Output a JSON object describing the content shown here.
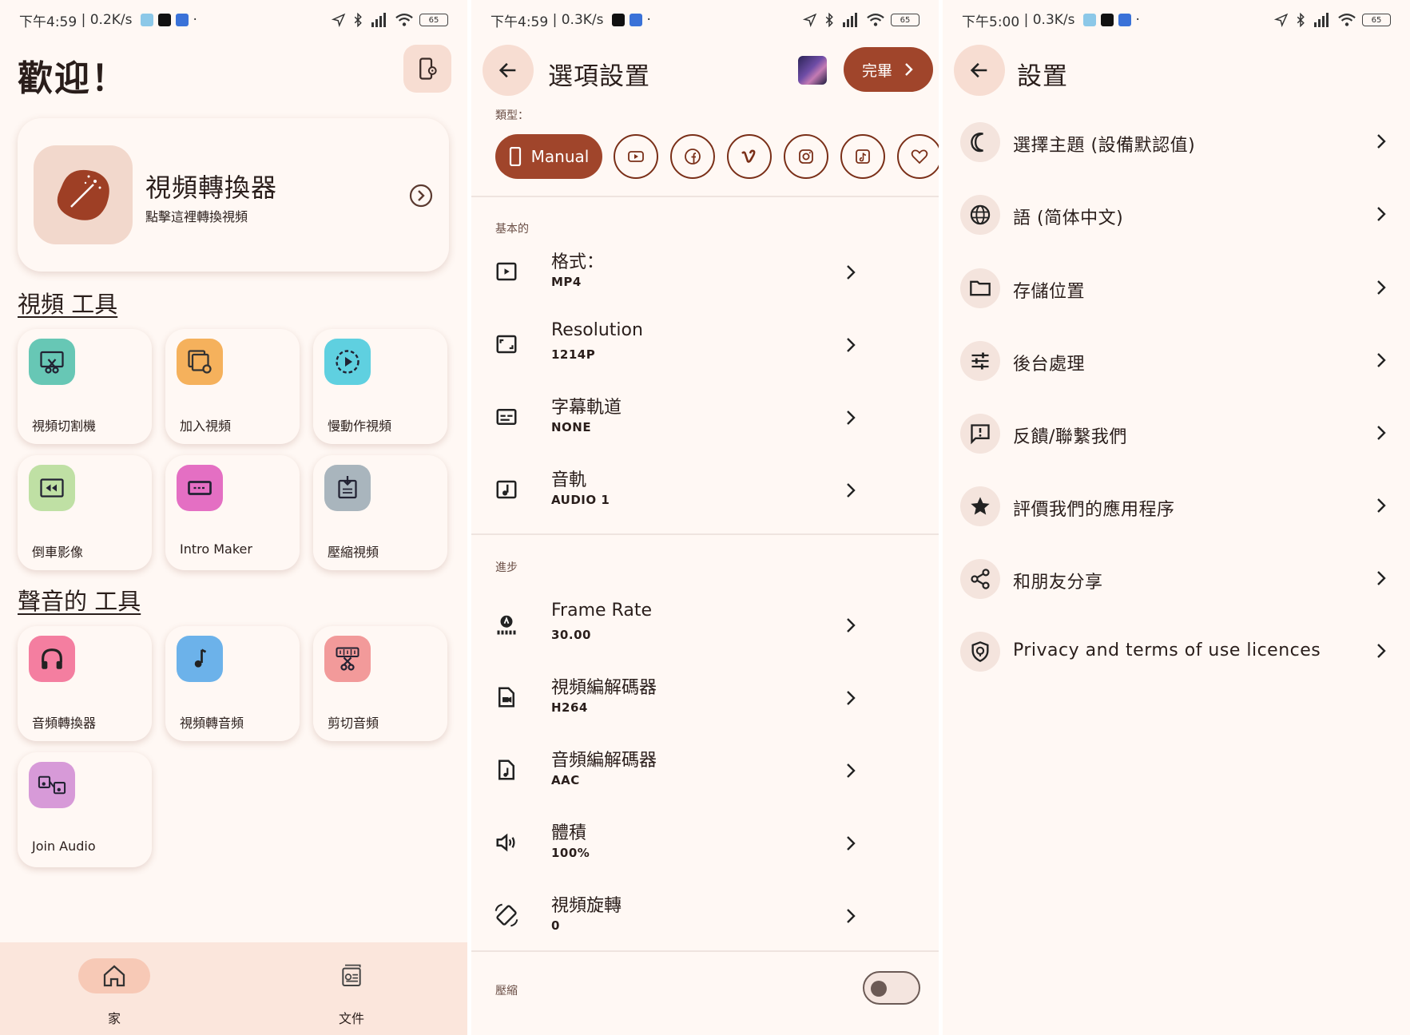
{
  "screen1": {
    "status": {
      "time": "下午4:59",
      "speed": "0.2K/s",
      "battery": "65"
    },
    "title": "歡迎！",
    "hero": {
      "title": "視頻轉換器",
      "subtitle": "點擊這裡轉換視頻"
    },
    "video_tools": {
      "heading": "視頻 工具",
      "items": [
        {
          "label": "視頻切割機",
          "color": "#67c7b5",
          "icon": "film-cut-icon"
        },
        {
          "label": "加入視頻",
          "color": "#f5b15c",
          "icon": "stack-video-icon"
        },
        {
          "label": "慢動作視頻",
          "color": "#5fd0e0",
          "icon": "slow-play-icon"
        },
        {
          "label": "倒車影像",
          "color": "#bfe0a4",
          "icon": "reverse-video-icon"
        },
        {
          "label": "Intro Maker",
          "color": "#e46fc3",
          "icon": "intro-icon"
        },
        {
          "label": "壓縮視頻",
          "color": "#a9b5bd",
          "icon": "compress-icon"
        }
      ]
    },
    "audio_tools": {
      "heading": "聲音的 工具",
      "items": [
        {
          "label": "音頻轉換器",
          "color": "#f47ea0",
          "icon": "headphones-icon"
        },
        {
          "label": "視頻轉音頻",
          "color": "#6cb2ea",
          "icon": "music-note-icon"
        },
        {
          "label": "剪切音頻",
          "color": "#f29a9a",
          "icon": "audio-cut-icon"
        },
        {
          "label": "Join Audio",
          "color": "#d79ad8",
          "icon": "join-audio-icon"
        }
      ]
    },
    "nav": {
      "home": "家",
      "files": "文件"
    }
  },
  "screen2": {
    "status": {
      "time": "下午4:59",
      "speed": "0.3K/s",
      "battery": "65"
    },
    "title": "選項設置",
    "done": "完畢",
    "type_label": "類型：",
    "manual": "Manual",
    "basic_label": "基本的",
    "basic": [
      {
        "title": "格式：",
        "value": "MP4",
        "icon": "play-box-icon"
      },
      {
        "title": "Resolution",
        "value": "1214P",
        "icon": "aspect-ratio-icon"
      },
      {
        "title": "字幕軌道",
        "value": "NONE",
        "icon": "subtitles-icon"
      },
      {
        "title": "音軌",
        "value": "AUDIO 1",
        "icon": "music-box-icon"
      }
    ],
    "advanced_label": "進步",
    "advanced": [
      {
        "title": "Frame Rate",
        "value": "30.00",
        "icon": "frame-rate-icon"
      },
      {
        "title": "視頻編解碼器",
        "value": "H264",
        "icon": "video-file-icon"
      },
      {
        "title": "音頻編解碼器",
        "value": "AAC",
        "icon": "audio-file-icon"
      },
      {
        "title": "體積",
        "value": "100%",
        "icon": "volume-icon"
      },
      {
        "title": "視頻旋轉",
        "value": "0",
        "icon": "rotate-icon"
      }
    ],
    "compress_label": "壓縮",
    "compress_on": false
  },
  "screen3": {
    "status": {
      "time": "下午5:00",
      "speed": "0.3K/s",
      "battery": "65"
    },
    "title": "設置",
    "items": [
      {
        "label": "選擇主題 (設備默認值)",
        "icon": "moon-icon"
      },
      {
        "label": "語 (简体中文)",
        "icon": "globe-icon"
      },
      {
        "label": "存儲位置",
        "icon": "folder-icon"
      },
      {
        "label": "後台處理",
        "icon": "sliders-icon"
      },
      {
        "label": "反饋/聯繫我們",
        "icon": "feedback-icon"
      },
      {
        "label": "評價我們的應用程序",
        "icon": "star-icon"
      },
      {
        "label": "和朋友分享",
        "icon": "share-icon"
      },
      {
        "label": "Privacy and terms of use licences",
        "icon": "shield-icon"
      }
    ]
  }
}
